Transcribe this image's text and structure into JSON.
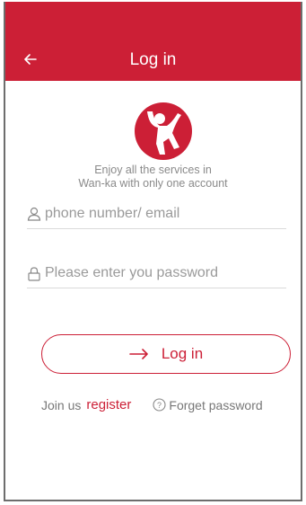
{
  "header": {
    "title": "Log in"
  },
  "tagline": {
    "line1": "Enjoy all the services in",
    "line2": "Wan-ka with only one account"
  },
  "form": {
    "account_placeholder": "phone number/ email",
    "password_placeholder": "Please enter you password",
    "submit_label": "Log in"
  },
  "footer": {
    "join_text": "Join us",
    "register_label": "register",
    "forget_label": "Forget password"
  },
  "colors": {
    "brand": "#cc1f36"
  },
  "icons": [
    "back-arrow-icon",
    "user-icon",
    "lock-icon",
    "arrow-right-icon",
    "question-circle-icon"
  ]
}
